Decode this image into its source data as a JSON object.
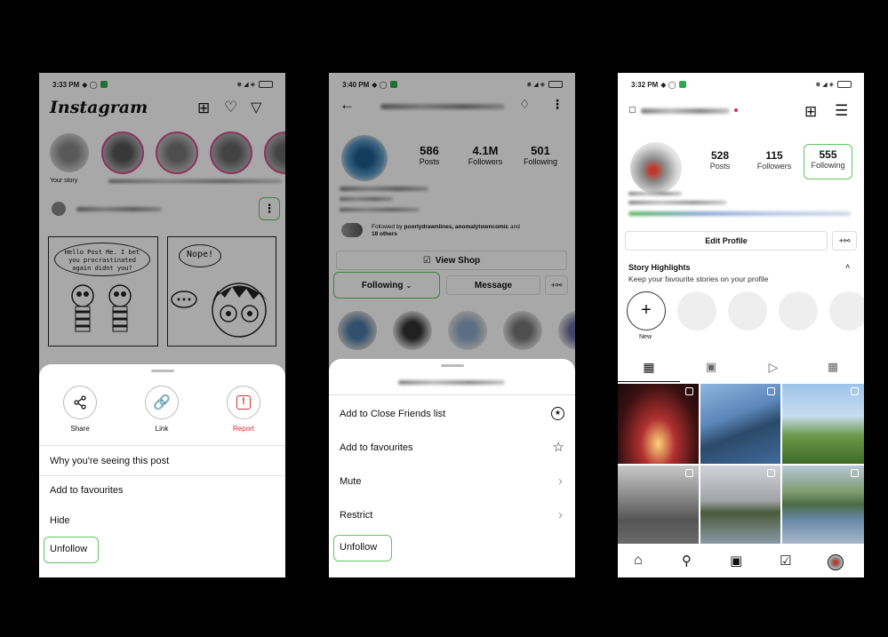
{
  "screens": [
    {
      "status_time": "3:33 PM",
      "app_title": "Instagram",
      "your_story_label": "Your story",
      "comic_text_1": "Hello Post Me. I bet you procrastinated again didnt you?",
      "comic_text_2": "Nope!",
      "actions": [
        {
          "label": "Share",
          "icon": "share-icon"
        },
        {
          "label": "Link",
          "icon": "link-icon"
        },
        {
          "label": "Report",
          "icon": "report-icon",
          "color": "#d32f2f"
        }
      ],
      "menu": [
        "Why you're seeing this post",
        "Add to favourites",
        "Hide",
        "Unfollow"
      ]
    },
    {
      "status_time": "3:40 PM",
      "stats": [
        {
          "value": "586",
          "label": "Posts"
        },
        {
          "value": "4.1M",
          "label": "Followers"
        },
        {
          "value": "501",
          "label": "Following"
        }
      ],
      "followed_by_prefix": "Followed by ",
      "followed_by_names": "poorlydrawnlines, anomalytowncomic",
      "followed_by_suffix": " and",
      "followed_by_others": "18 others",
      "view_shop": "View Shop",
      "following_button": "Following",
      "message_button": "Message",
      "menu": [
        {
          "label": "Add to Close Friends list",
          "icon": "star-circle-icon"
        },
        {
          "label": "Add to favourites",
          "icon": "star-icon"
        },
        {
          "label": "Mute",
          "icon": "chevron-right-icon"
        },
        {
          "label": "Restrict",
          "icon": "chevron-right-icon"
        },
        {
          "label": "Unfollow",
          "icon": ""
        }
      ]
    },
    {
      "status_time": "3:32 PM",
      "stats": [
        {
          "value": "528",
          "label": "Posts"
        },
        {
          "value": "115",
          "label": "Followers"
        },
        {
          "value": "555",
          "label": "Following"
        }
      ],
      "edit_profile": "Edit Profile",
      "highlights_title": "Story Highlights",
      "highlights_sub": "Keep your favourite stories on your profile",
      "new_label": "New"
    }
  ],
  "colors": {
    "highlight_green": "#62c462",
    "report_red": "#d32f2f",
    "scrim": "#000000"
  }
}
